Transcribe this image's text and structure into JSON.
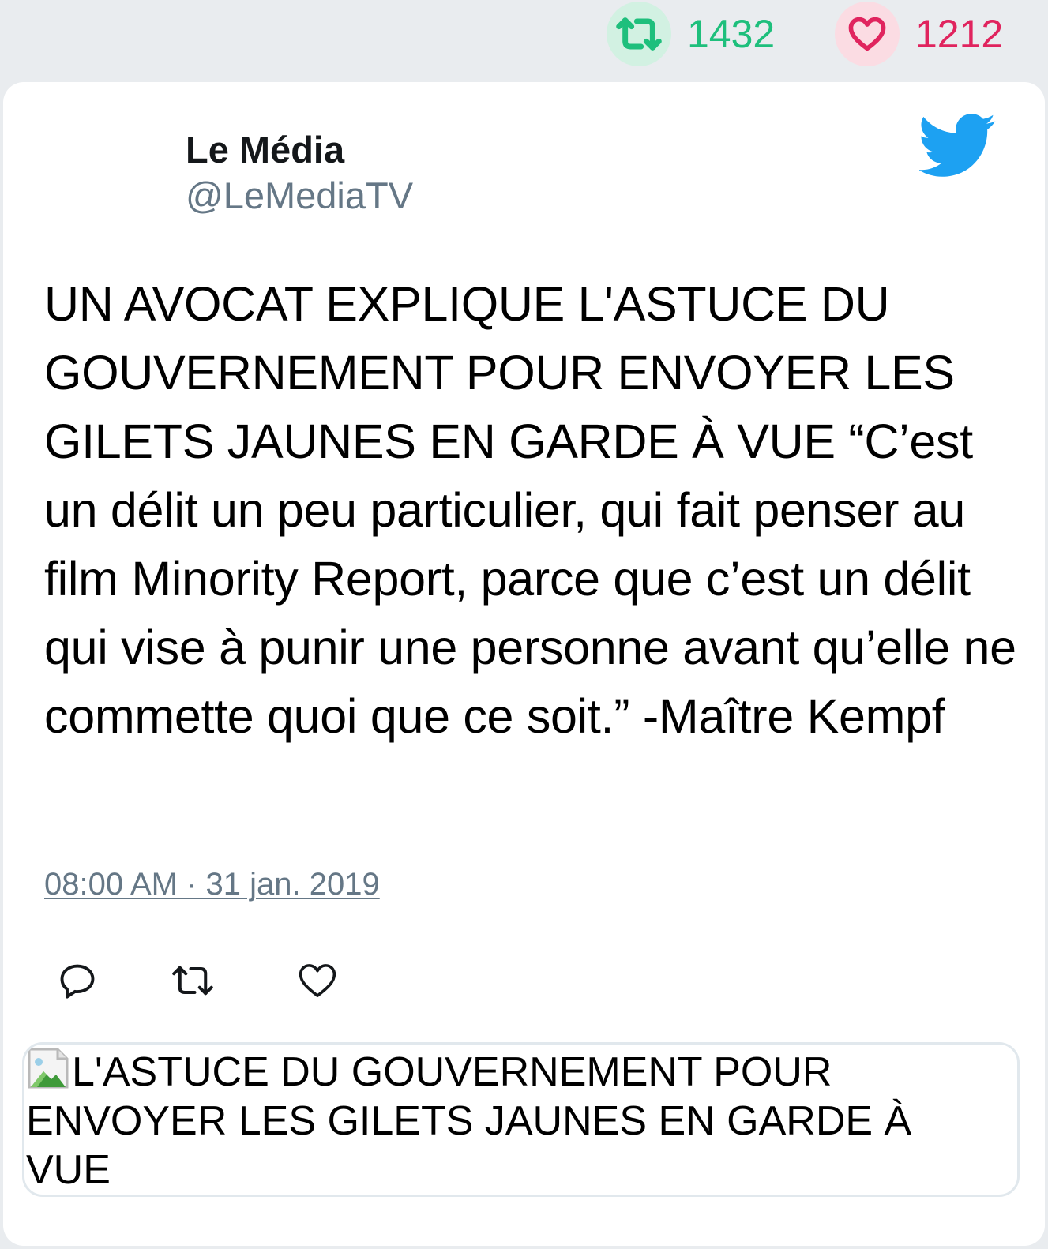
{
  "stats": {
    "retweets": "1432",
    "likes": "1212"
  },
  "tweet": {
    "author_name": "Le Média",
    "author_handle": "@LeMediaTV",
    "text": "UN AVOCAT EXPLIQUE L'ASTUCE DU GOUVERNEMENT POUR ENVOYER LES GILETS JAUNES EN GARDE À VUE “C’est un délit un peu particulier, qui fait penser au film Minority Report, parce que c’est un délit qui vise à punir une personne avant qu’elle ne commette quoi que ce soit.” -Maître Kempf",
    "timestamp": "08:00 AM · 31 jan. 2019"
  },
  "link_card": {
    "image_alt": "L'ASTUCE DU GOUVERNEMENT POUR ENVOYER LES GILETS JAUNES EN GARDE À VUE"
  },
  "icons": {
    "retweet": "retweet-icon",
    "like": "heart-icon",
    "reply": "reply-icon",
    "brand": "twitter-bird-icon",
    "broken_image": "broken-image-icon"
  },
  "colors": {
    "retweet_green": "#1ebf7c",
    "like_red": "#e0245e",
    "twitter_blue": "#1da1f2",
    "handle_gray": "#657786"
  }
}
